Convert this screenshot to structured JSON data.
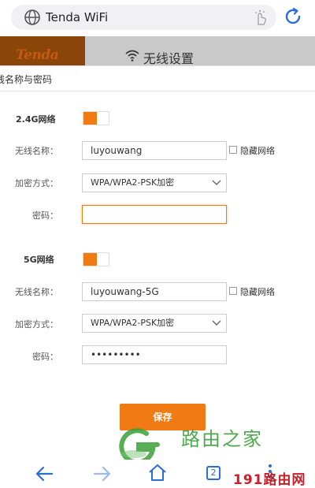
{
  "browser": {
    "url_display": "Tenda WiFi",
    "icons": [
      "globe-icon",
      "gesture-icon",
      "refresh-icon"
    ]
  },
  "router_header": {
    "logo": "Tenda",
    "title": "无线设置"
  },
  "modal": {
    "title": "线名称与密码",
    "band_24": {
      "section_label": "2.4G网络",
      "enabled": true,
      "ssid_label": "无线名称：",
      "ssid_value": "luyouwang",
      "hide_label": "隐藏网络",
      "hidden": false,
      "encryption_label": "加密方式：",
      "encryption_value": "WPA/WPA2-PSK加密",
      "password_label": "密码：",
      "password_value": ""
    },
    "band_5": {
      "section_label": "5G网络",
      "enabled": true,
      "ssid_label": "无线名称：",
      "ssid_value": "luyouwang-5G",
      "hide_label": "隐藏网络",
      "hidden": false,
      "encryption_label": "加密方式：",
      "encryption_value": "WPA/WPA2-PSK加密",
      "password_label": "密码：",
      "password_value": "•••••••••"
    },
    "save_label": "保存"
  },
  "watermark": {
    "text": "路由之家",
    "site": "191路由网"
  },
  "bottom_nav": {
    "tab_count": "2",
    "icons": [
      "back-arrow-icon",
      "forward-arrow-icon",
      "home-icon",
      "tabs-icon",
      "menu-dots-icon"
    ]
  },
  "colors": {
    "accent": "#f07b14",
    "browser_blue": "#2a6ed3",
    "watermark_green": "#3aa03a",
    "watermark_red": "#c8202a"
  }
}
